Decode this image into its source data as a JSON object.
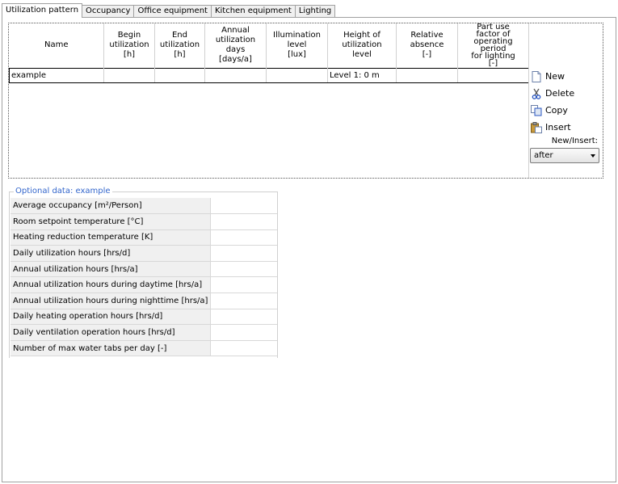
{
  "tabs": [
    {
      "label": "Utilization pattern",
      "active": true
    },
    {
      "label": "Occupancy",
      "active": false
    },
    {
      "label": "Office equipment",
      "active": false
    },
    {
      "label": "Kitchen equipment",
      "active": false
    },
    {
      "label": "Lighting",
      "active": false
    }
  ],
  "grid": {
    "columns": [
      [
        "Name"
      ],
      [
        "Begin",
        "utilization",
        "[h]"
      ],
      [
        "End",
        "utilization",
        "[h]"
      ],
      [
        "Annual",
        "utilization",
        "days",
        "[days/a]"
      ],
      [
        "Illumination",
        "level",
        "[lux]"
      ],
      [
        "Height of",
        "utilization",
        "level"
      ],
      [
        "Relative",
        "absence",
        "[-]"
      ],
      [
        "Part use",
        "factor of",
        "operating period",
        "for lighting",
        "[-]"
      ]
    ],
    "rows": [
      [
        "example",
        "",
        "",
        "",
        "",
        "Level 1: 0 m",
        "",
        ""
      ]
    ]
  },
  "side": {
    "new": "New",
    "delete": "Delete",
    "copy": "Copy",
    "insert": "Insert",
    "new_insert_label": "New/Insert:",
    "new_insert_value": "after"
  },
  "optional": {
    "title": "Optional data: example",
    "rows": [
      {
        "label": "Average occupancy  [m²/Person]",
        "value": ""
      },
      {
        "label": "Room setpoint temperature  [°C]",
        "value": ""
      },
      {
        "label": "Heating reduction temperature  [K]",
        "value": ""
      },
      {
        "label": "Daily utilization hours  [hrs/d]",
        "value": ""
      },
      {
        "label": "Annual utilization hours  [hrs/a]",
        "value": ""
      },
      {
        "label": "Annual utilization hours during daytime  [hrs/a]",
        "value": ""
      },
      {
        "label": "Annual utilization hours during nighttime  [hrs/a]",
        "value": ""
      },
      {
        "label": "Daily heating operation hours  [hrs/d]",
        "value": ""
      },
      {
        "label": "Daily ventilation operation hours  [hrs/d]",
        "value": ""
      },
      {
        "label": "Number of max water tabs per day  [-]",
        "value": ""
      }
    ]
  },
  "colors": {
    "group_title": "#3366cc",
    "label_bg": "#f0f0f0"
  }
}
